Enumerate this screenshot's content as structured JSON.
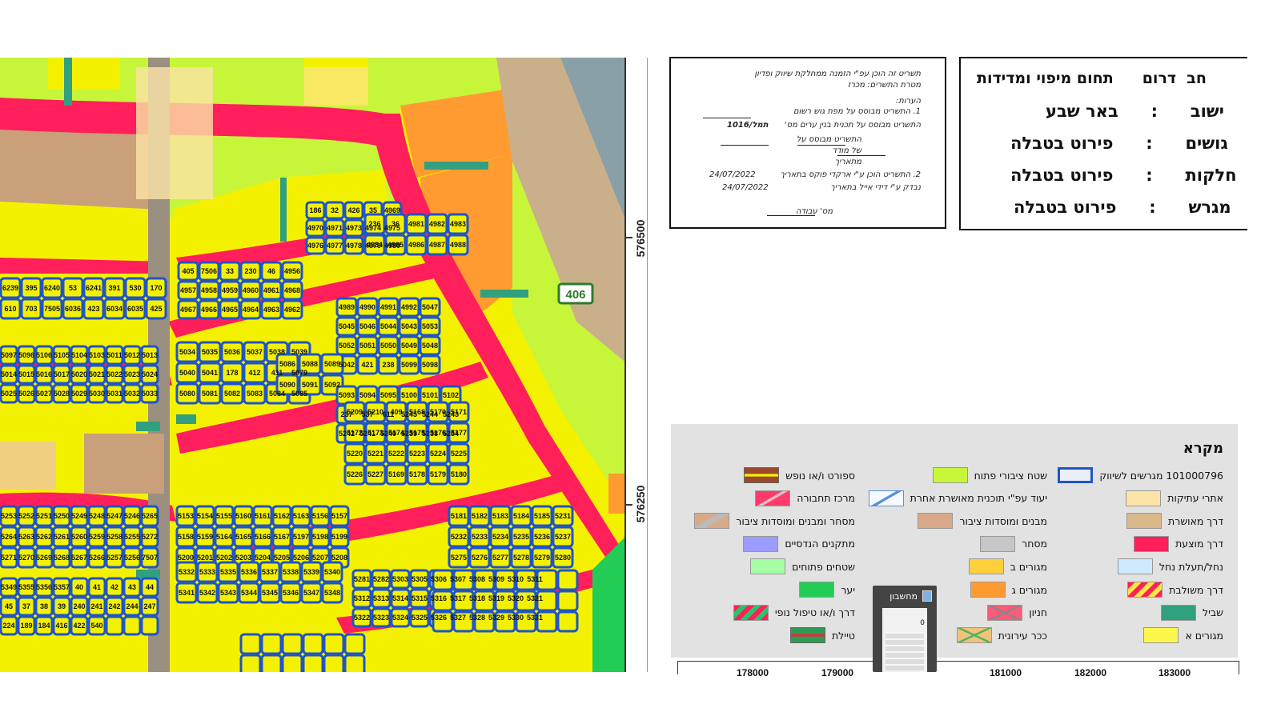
{
  "map": {
    "coord_labels": [
      "576500",
      "576250"
    ],
    "road_number": "406",
    "parcels": [
      "6239",
      "395",
      "6240",
      "53",
      "6241",
      "391",
      "530",
      "170",
      "610",
      "703",
      "7505",
      "6036",
      "423",
      "6034",
      "6035",
      "425",
      "405",
      "7506",
      "33",
      "230",
      "46",
      "4956",
      "4957",
      "4958",
      "4959",
      "4960",
      "4961",
      "4968",
      "4967",
      "4966",
      "4965",
      "4964",
      "4963",
      "4962",
      "186",
      "32",
      "426",
      "35",
      "4969",
      "4970",
      "4971",
      "4973",
      "4974",
      "4975",
      "4976",
      "4977",
      "4978",
      "4979",
      "4980",
      "236",
      "36",
      "4981",
      "4982",
      "4983",
      "4984",
      "4985",
      "4986",
      "4987",
      "4988",
      "4989",
      "4990",
      "4991",
      "4992",
      "5047",
      "5045",
      "5046",
      "5044",
      "5043",
      "5053",
      "5052",
      "5051",
      "5050",
      "5049",
      "5048",
      "5042",
      "421",
      "238",
      "5099",
      "5098",
      "5097",
      "5096",
      "5106",
      "5105",
      "5104",
      "5103",
      "5011",
      "5012",
      "5013",
      "5014",
      "5015",
      "5016",
      "5017",
      "5020",
      "5021",
      "5022",
      "5023",
      "5024",
      "5025",
      "5026",
      "5027",
      "5028",
      "5029",
      "5030",
      "5031",
      "5032",
      "5033",
      "5034",
      "5035",
      "5036",
      "5037",
      "5038",
      "5039",
      "5040",
      "5041",
      "178",
      "412",
      "411",
      "5079",
      "5080",
      "5081",
      "5082",
      "5083",
      "5084",
      "5085",
      "5086",
      "5088",
      "5089",
      "5090",
      "5091",
      "5092",
      "5093",
      "5094",
      "5095",
      "5100",
      "5101",
      "5102",
      "237",
      "537",
      "611",
      "5245",
      "5244",
      "5243",
      "5242",
      "5241",
      "5240",
      "5239",
      "5238",
      "5254",
      "5253",
      "5252",
      "5251",
      "5250",
      "5249",
      "5248",
      "5247",
      "5246",
      "5265",
      "5264",
      "5263",
      "5262",
      "5261",
      "5260",
      "5259",
      "5258",
      "5255",
      "5272",
      "5271",
      "5270",
      "5269",
      "5268",
      "5267",
      "5266",
      "5257",
      "5256",
      "7507",
      "5153",
      "5154",
      "5155",
      "5160",
      "5161",
      "5162",
      "5163",
      "5156",
      "5157",
      "5158",
      "5159",
      "5164",
      "5165",
      "5166",
      "5167",
      "5197",
      "5198",
      "5199",
      "5200",
      "5201",
      "5202",
      "5203",
      "5204",
      "5205",
      "5206",
      "5207",
      "5208",
      "5209",
      "5210",
      "409",
      "5168",
      "5170",
      "5171",
      "5172",
      "5173",
      "5174",
      "5175",
      "5176",
      "5177",
      "5220",
      "5221",
      "5222",
      "5223",
      "5224",
      "5225",
      "5226",
      "5227",
      "5169",
      "5178",
      "5179",
      "5180",
      "5181",
      "5182",
      "5183",
      "5184",
      "5185",
      "5231",
      "5232",
      "5233",
      "5234",
      "5235",
      "5236",
      "5237",
      "5275",
      "5276",
      "5277",
      "5278",
      "5279",
      "5280",
      "5281",
      "5282",
      "5303",
      "5305",
      "5306",
      "5307",
      "5308",
      "5309",
      "5310",
      "5311",
      "5312",
      "5313",
      "5314",
      "5315",
      "5316",
      "5317",
      "5318",
      "5319",
      "5320",
      "5321",
      "5322",
      "5323",
      "5324",
      "5325",
      "5326",
      "5327",
      "5328",
      "5329",
      "5330",
      "5331",
      "5332",
      "5333",
      "5335",
      "5336",
      "5337",
      "5338",
      "5339",
      "5340",
      "5341",
      "5342",
      "5343",
      "5344",
      "5345",
      "5346",
      "5347",
      "5348",
      "5349",
      "5355",
      "5356",
      "5357",
      "40",
      "41",
      "42",
      "43",
      "44",
      "45",
      "37",
      "38",
      "39",
      "240",
      "241",
      "242",
      "244",
      "247",
      "224",
      "189",
      "184",
      "416",
      "422",
      "540"
    ]
  },
  "header": {
    "rows": [
      {
        "value": "תחום מיפוי ומדידות",
        "label": "חב  דרום"
      },
      {
        "value": "באר שבע",
        "label": "ישוב"
      },
      {
        "value": "פירוט בטבלה",
        "label": "גושים"
      },
      {
        "value": "פירוט בטבלה",
        "label": "חלקות"
      },
      {
        "value": "פירוט בטבלה",
        "label": "מגרש"
      }
    ],
    "separator": ":"
  },
  "notes": {
    "line1": "תשריט זה הוכן עפ\"י הזמנה ממחלקת  שיווק ופדיון",
    "line2": "מטרת התשרים: מכרז",
    "line3": "הערות:",
    "line4": "1. התשריט  מבוסס על מפת גוש רשום",
    "line5": "התשריט מבוסס על תכנית בנין ערים מס'",
    "plan_no": "תמל/1016",
    "line6": "התשריט מבוסס על",
    "line7": "של מודד",
    "line8": "מתאריך",
    "line9": "2. התשריט הוכן ע\"י   ארקדי פוקס        בתאריך",
    "date1": "24/07/2022",
    "line10": "נבדק ע\"י   דידי אייל                 בתאריך",
    "date2": "24/07/2022",
    "line11": "מס' עבודה"
  },
  "legend": {
    "title": "מקרא",
    "col1": [
      {
        "label": "101000796 מגרשים לשיווק",
        "color": "#e9eef7",
        "border": "#1f55c8",
        "pattern": "none"
      },
      {
        "label": "אתרי עתיקות",
        "color": "#fce3a7",
        "border": "#999999",
        "pattern": "none"
      },
      {
        "label": "דרך מאושרת",
        "color": "#d9b88a",
        "border": "#999999",
        "pattern": "none"
      },
      {
        "label": "דרך מוצעת",
        "color": "#ff1f5a",
        "border": "#999999",
        "pattern": "none"
      },
      {
        "label": "נחל/תעלת נחל",
        "color": "#cfe9ff",
        "border": "#999999",
        "pattern": "none"
      },
      {
        "label": "דרך משולבת",
        "color": "#ffe44a",
        "border": "#999999",
        "pattern": "stripes-red"
      },
      {
        "label": "שביל",
        "color": "#31a07e",
        "border": "#999999",
        "pattern": "none"
      },
      {
        "label": "מגורים א",
        "color": "#fbf74c",
        "border": "#999999",
        "pattern": "none"
      }
    ],
    "col2": [
      {
        "label": "שטח ציבורי פתוח",
        "color": "#c7f53a",
        "border": "#999999",
        "pattern": "none"
      },
      {
        "label": "יעוד עפ\"י תוכנית מאושרת אחרת",
        "color": "#f4f8ff",
        "border": "#5a8fd8",
        "pattern": "diag-blue"
      },
      {
        "label": "מבנים ומוסדות ציבור",
        "color": "#d9a98a",
        "border": "#999999",
        "pattern": "none"
      },
      {
        "label": "מסחר",
        "color": "#c6c6c8",
        "border": "#999999",
        "pattern": "none"
      },
      {
        "label": "מגורים ב",
        "color": "#ffcf3c",
        "border": "#999999",
        "pattern": "none"
      },
      {
        "label": "מגורים ג",
        "color": "#ff9b30",
        "border": "#999999",
        "pattern": "none"
      },
      {
        "label": "חניון",
        "color": "#ff5a78",
        "border": "#999999",
        "pattern": "cross"
      },
      {
        "label": "ככר עירונית",
        "color": "#f0c27a",
        "border": "#999999",
        "pattern": "cross-green"
      }
    ],
    "col3": [
      {
        "label": "ספורט ו/או נופש",
        "color": "#9a4a2a",
        "border": "#666666",
        "pattern": "yellow-bar"
      },
      {
        "label": "מרכז תחבורה",
        "color": "#ff3b6b",
        "border": "#999999",
        "pattern": "diag-white"
      },
      {
        "label": "מסחר ומבנים ומוסדות ציבור",
        "color": "#d9a98a",
        "border": "#999999",
        "pattern": "diag-gray"
      },
      {
        "label": "מתקנים הנדסיים",
        "color": "#9c9cff",
        "border": "#999999",
        "pattern": "none"
      },
      {
        "label": "שטחים פתוחים",
        "color": "#a7ffa5",
        "border": "#999999",
        "pattern": "none"
      },
      {
        "label": "יער",
        "color": "#22cc55",
        "border": "#999999",
        "pattern": "none"
      },
      {
        "label": "דרך ו/או טיפול נופי",
        "color": "#29c46a",
        "border": "#999999",
        "pattern": "stripes-red"
      },
      {
        "label": "טיילת",
        "color": "#2f9a55",
        "border": "#666666",
        "pattern": "red-bar"
      }
    ]
  },
  "axis": {
    "x_labels": [
      "178000",
      "179000",
      "181000",
      "182000",
      "183000"
    ]
  },
  "calculator": {
    "title": "מחשבון",
    "display": "0"
  }
}
